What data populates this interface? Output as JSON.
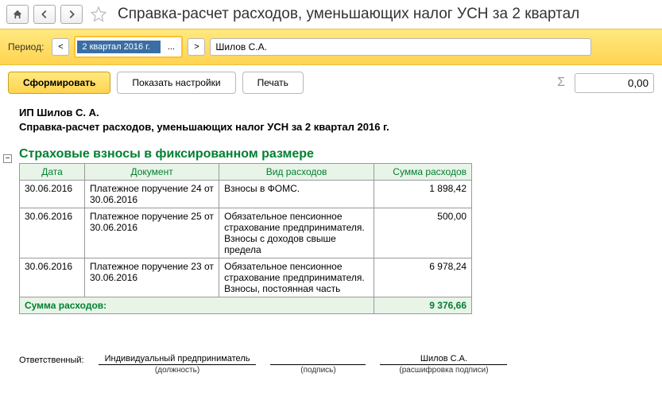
{
  "header": {
    "title": "Справка-расчет расходов, уменьшающих налог УСН  за 2 квартал"
  },
  "period_bar": {
    "label": "Период:",
    "value": "2 квартал 2016 г.",
    "user": "Шилов С.А."
  },
  "toolbar": {
    "generate": "Сформировать",
    "settings": "Показать настройки",
    "print": "Печать",
    "sum": "0,00"
  },
  "report": {
    "ip_name": "ИП Шилов С. А.",
    "title": "Справка-расчет расходов, уменьшающих налог УСН  за 2 квартал 2016 г.",
    "section_title": "Страховые взносы в фиксированном размере",
    "columns": {
      "date": "Дата",
      "doc": "Документ",
      "type": "Вид расходов",
      "sum": "Сумма расходов"
    },
    "rows": [
      {
        "date": "30.06.2016",
        "doc": "Платежное поручение 24 от 30.06.2016",
        "type": "Взносы в ФОМС.",
        "sum": "1 898,42"
      },
      {
        "date": "30.06.2016",
        "doc": "Платежное поручение 25 от 30.06.2016",
        "type": "Обязательное пенсионное страхование предпринимателя. Взносы с доходов свыше предела",
        "sum": "500,00"
      },
      {
        "date": "30.06.2016",
        "doc": "Платежное поручение 23 от 30.06.2016",
        "type": "Обязательное пенсионное страхование предпринимателя. Взносы, постоянная часть",
        "sum": "6 978,24"
      }
    ],
    "total_label": "Сумма расходов:",
    "total_sum": "9 376,66"
  },
  "signatures": {
    "responsible": "Ответственный:",
    "position_value": "Индивидуальный предприниматель",
    "position_caption": "(должность)",
    "sign_caption": "(подпись)",
    "name_value": "Шилов С.А.",
    "name_caption": "(расшифровка подписи)"
  }
}
